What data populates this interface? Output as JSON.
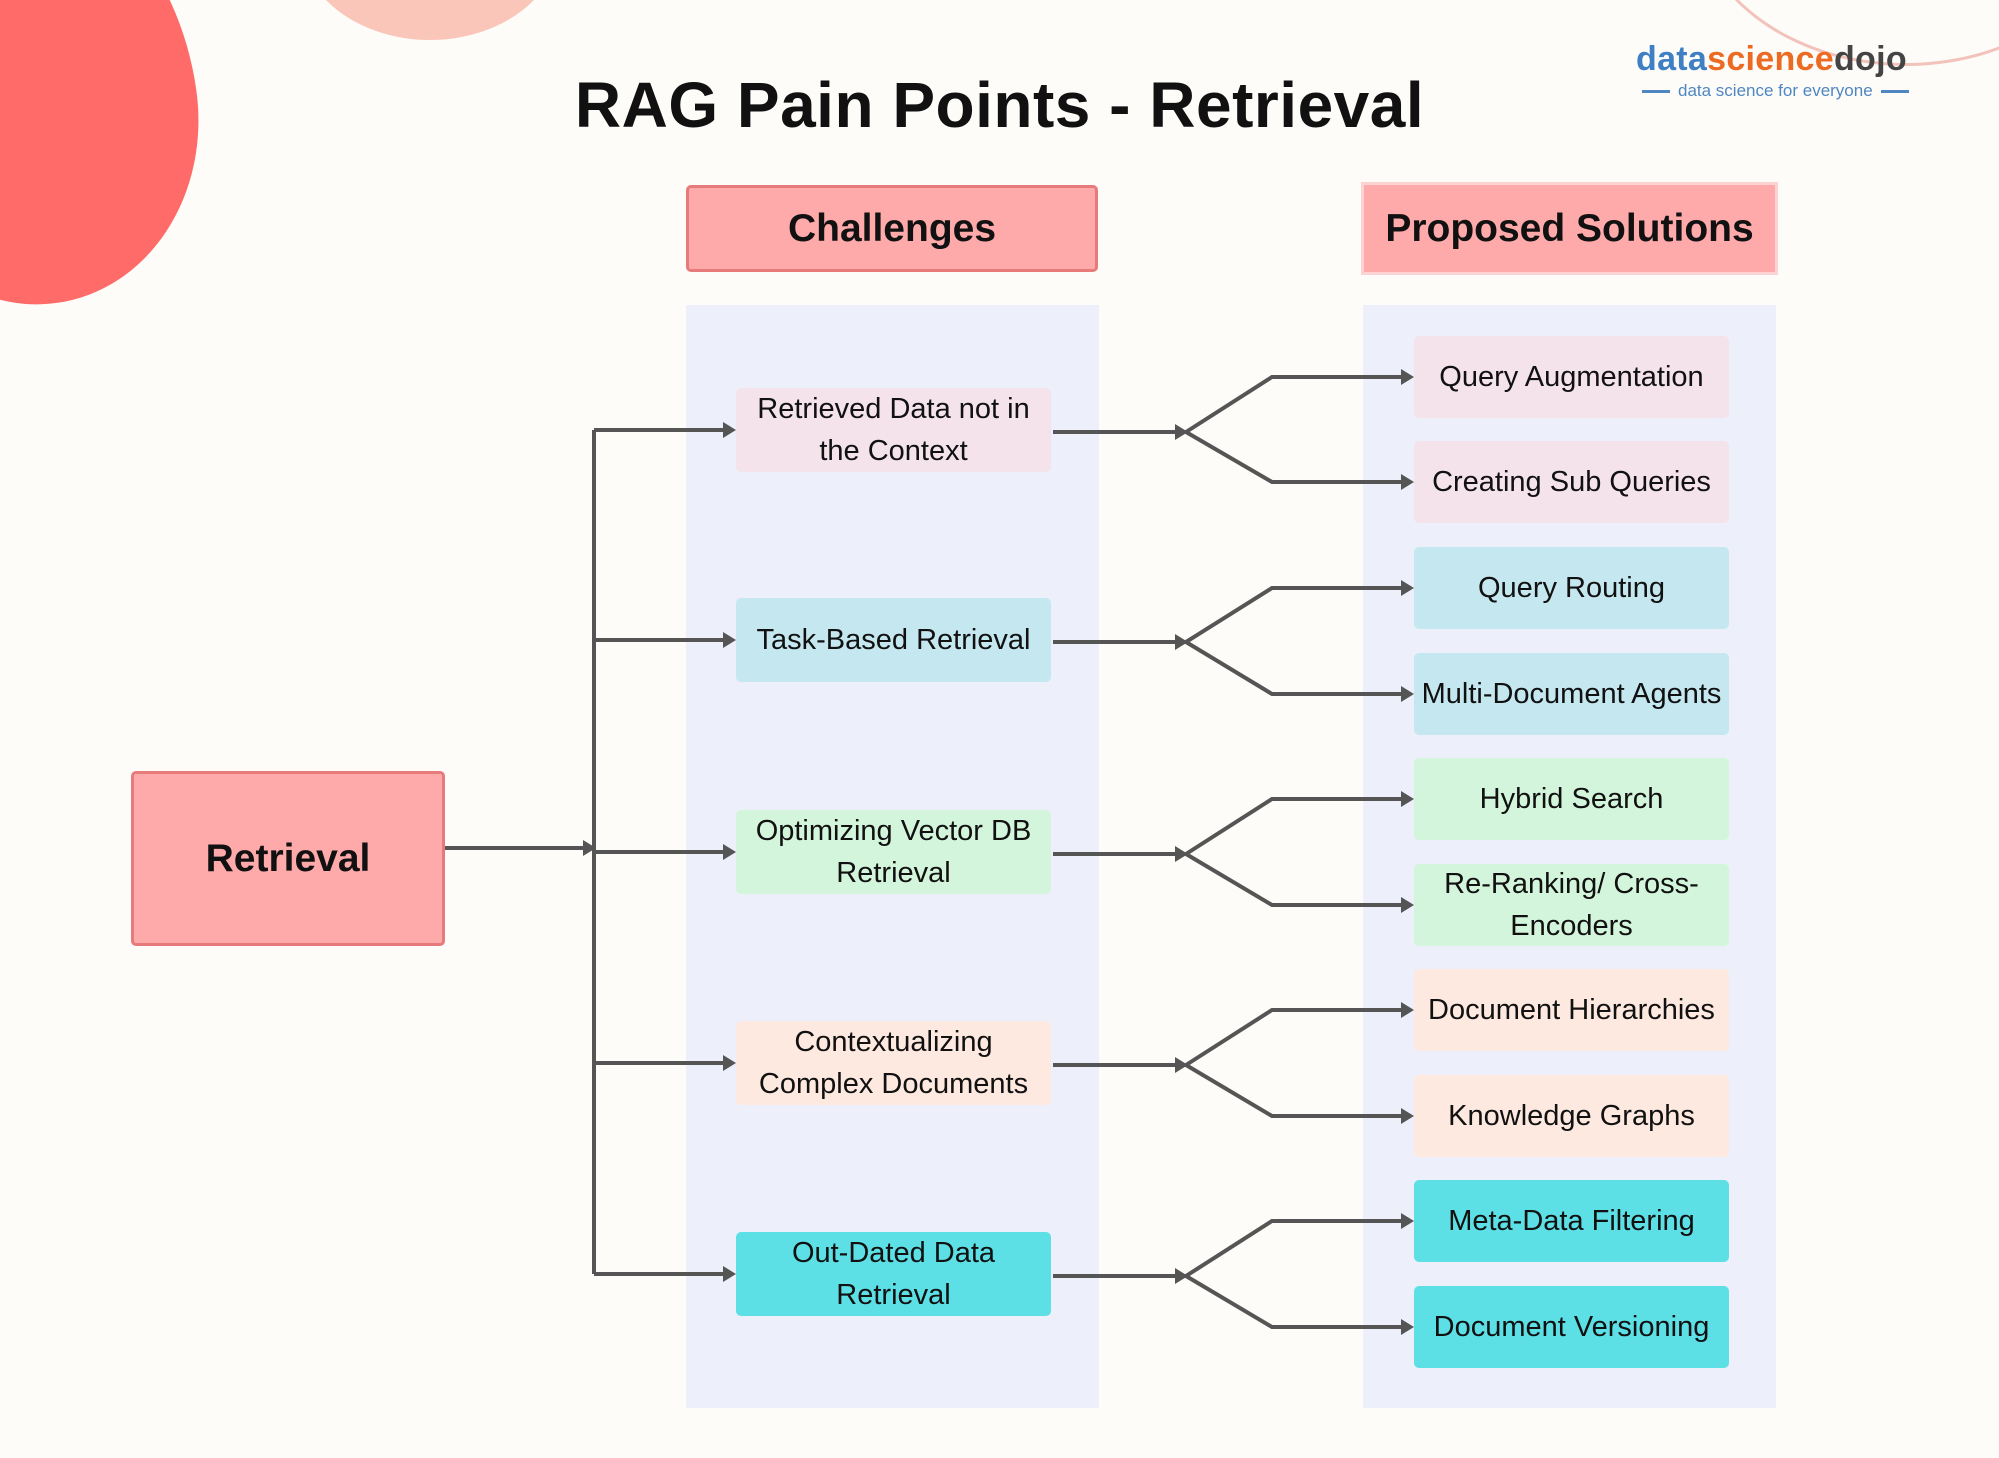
{
  "title": "RAG Pain Points - Retrieval",
  "logo": {
    "part1": "data",
    "part2": "science",
    "part3": "dojo",
    "tagline": "data science for everyone"
  },
  "headers": {
    "challenges": "Challenges",
    "solutions": "Proposed Solutions"
  },
  "root": {
    "label": "Retrieval"
  },
  "colors": {
    "header_fill": "#fea9aa",
    "header_border": "#e77a7b",
    "column_bg": "#edf0fb",
    "connector": "#555555",
    "pink": "#f4e3ea",
    "blue": "#c4e7f0",
    "green": "#d3f5db",
    "peach": "#fde9e0",
    "cyan": "#5ddfe6"
  },
  "challenges": [
    {
      "label": "Retrieved Data not in the Context",
      "color": "pink",
      "solutions": [
        "Query Augmentation",
        "Creating Sub Queries"
      ]
    },
    {
      "label": "Task-Based Retrieval",
      "color": "blue",
      "solutions": [
        "Query Routing",
        "Multi-Document Agents"
      ]
    },
    {
      "label": "Optimizing Vector DB Retrieval",
      "color": "green",
      "solutions": [
        "Hybrid Search",
        "Re-Ranking/ Cross-Encoders"
      ]
    },
    {
      "label": "Contextualizing Complex Documents",
      "color": "peach",
      "solutions": [
        "Document Hierarchies",
        "Knowledge Graphs"
      ]
    },
    {
      "label": "Out-Dated Data Retrieval",
      "color": "cyan",
      "solutions": [
        "Meta-Data Filtering",
        "Document Versioning"
      ]
    }
  ]
}
